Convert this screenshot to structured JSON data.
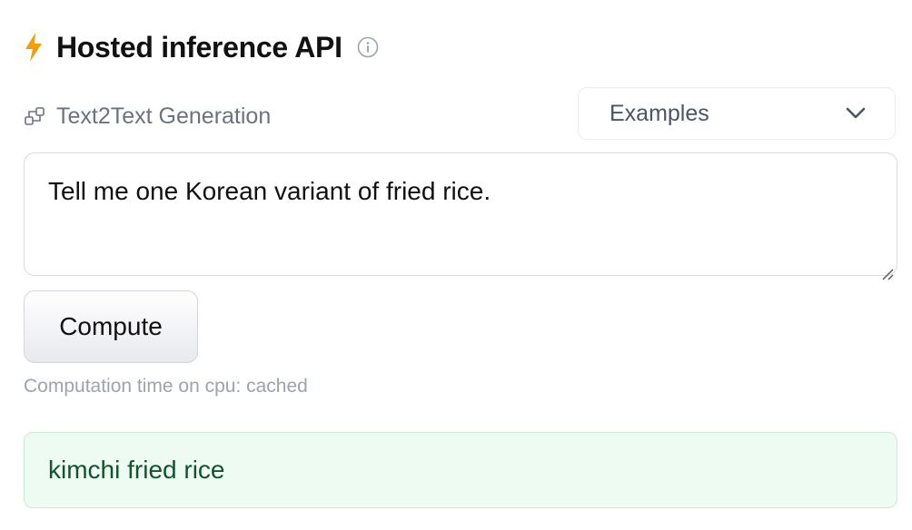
{
  "header": {
    "title": "Hosted inference API",
    "bolt_icon": "lightning-bolt-icon",
    "info_icon": "info-icon"
  },
  "task": {
    "icon": "text2text-task-icon",
    "label": "Text2Text Generation"
  },
  "examples_dropdown": {
    "label": "Examples",
    "icon": "chevron-down-icon"
  },
  "input": {
    "value": "Tell me one Korean variant of fried rice."
  },
  "compute_button": {
    "label": "Compute"
  },
  "status": {
    "computation_time": "Computation time on cpu: cached"
  },
  "output": {
    "text": "kimchi fried rice"
  },
  "colors": {
    "accent_bolt": "#f59e0b",
    "output_background": "#eefbf3",
    "output_border": "#c8ecd6",
    "output_text": "#14532d"
  }
}
